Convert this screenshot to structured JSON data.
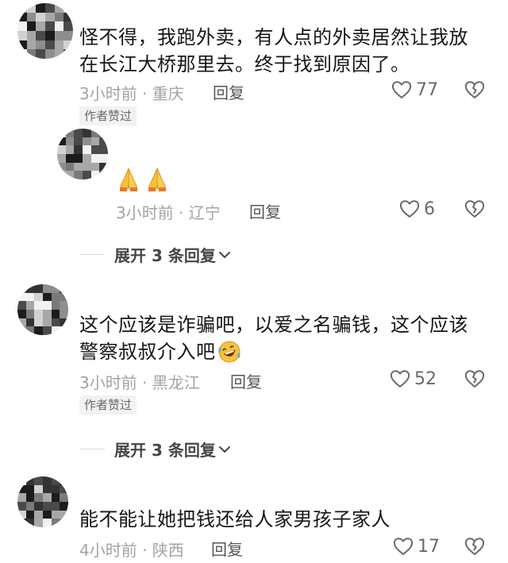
{
  "comments": [
    {
      "text_line1": "怪不得，我跑外卖，有人点的外卖居然让我放",
      "text_line2": "在长江大桥那里去。终于找到原因了。",
      "time": "3小时前 · 重庆",
      "reply_label": "回复",
      "badge": "作者赞过",
      "likes": "77"
    },
    {
      "time": "3小时前 · 辽宁",
      "reply_label": "回复",
      "likes": "6",
      "emoji": [
        "folded-hands",
        "folded-hands"
      ]
    },
    {
      "text_line1": "这个应该是诈骗吧，以爱之名骗钱，这个应该",
      "text_line2": "警察叔叔介入吧",
      "time": "3小时前 · 黑龙江",
      "reply_label": "回复",
      "badge": "作者赞过",
      "likes": "52",
      "emoji": "rolling-on-floor-laughing"
    },
    {
      "text_line1": "能不能让她把钱还给人家男孩子家人",
      "time": "4小时前 · 陕西",
      "reply_label": "回复",
      "likes": "17"
    }
  ],
  "expand_replies_1": "展开 3 条回复",
  "expand_replies_2": "展开 3 条回复",
  "icons": {
    "like": "heart-outline-icon",
    "dislike": "broken-heart-icon",
    "expand": "chevron-down-icon"
  },
  "colors": {
    "text": "#161616",
    "meta": "#a3a3a3",
    "badge_bg": "#f2f2f4",
    "emoji_yellow": "#f7c23a"
  }
}
